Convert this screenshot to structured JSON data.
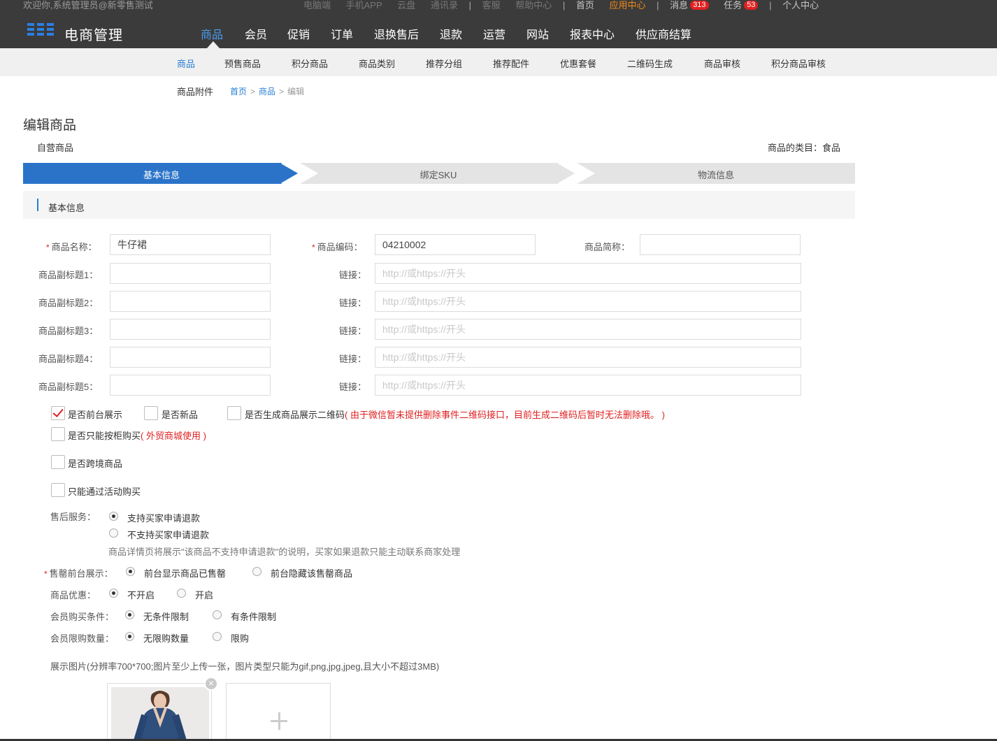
{
  "header": {
    "welcome": "欢迎你,系统管理员@新零售测试",
    "links": {
      "pc": "电脑端",
      "app": "手机APP",
      "cloud": "云盘",
      "contacts": "通讯录",
      "service": "客服",
      "help": "帮助中心",
      "home": "首页",
      "app_center": "应用中心",
      "messages": "消息",
      "messages_count": "313",
      "tasks": "任务",
      "tasks_count": "53",
      "profile": "个人中心"
    },
    "logo_text": "电商管理",
    "nav": [
      "商品",
      "会员",
      "促销",
      "订单",
      "退换售后",
      "退款",
      "运营",
      "网站",
      "报表中心",
      "供应商结算"
    ],
    "active_nav": "商品"
  },
  "subnav": [
    "商品",
    "预售商品",
    "积分商品",
    "商品类别",
    "推荐分组",
    "推荐配件",
    "优惠套餐",
    "二维码生成",
    "商品审核",
    "积分商品审核"
  ],
  "attach_label": "商品附件",
  "breadcrumb": {
    "home": "首页",
    "goods": "商品",
    "current": "编辑",
    "sep": ">"
  },
  "page_title": "编辑商品",
  "self_goods": "自营商品",
  "category": "商品的类目：食品",
  "steps": [
    "基本信息",
    "绑定SKU",
    "物流信息"
  ],
  "section_title": "基本信息",
  "form": {
    "name_label": "商品名称：",
    "name_value": "牛仔裙",
    "code_label": "商品编码：",
    "code_value": "04210002",
    "short_label": "商品简称：",
    "short_value": "",
    "link_label": "链接：",
    "link_placeholder": "http://或https://开头",
    "subtitles": [
      "商品副标题1：",
      "商品副标题2：",
      "商品副标题3：",
      "商品副标题4：",
      "商品副标题5："
    ],
    "checkboxes": {
      "front_show": "是否前台展示",
      "is_new": "是否新品",
      "qrcode": "是否生成商品展示二维码",
      "qrcode_warn": "( 由于微信暂未提供删除事件二维码接口，目前生成二维码后暂时无法删除哦。 )",
      "cabinet": "是否只能按柜购买",
      "cabinet_warn": "( 外贸商城使用 )",
      "cross_border": "是否跨境商品",
      "activity_only": "只能通过活动购买"
    },
    "after_sale_label": "售后服务：",
    "after_sale_yes": "支持买家申请退款",
    "after_sale_no": "不支持买家申请退款",
    "after_sale_note": "商品详情页将展示\"该商品不支持申请退款\"的说明，买家如果退款只能主动联系商家处理",
    "soldout_label": "售罄前台展示：",
    "soldout_show": "前台显示商品已售罄",
    "soldout_hide": "前台隐藏该售罄商品",
    "discount_label": "商品优惠：",
    "discount_off": "不开启",
    "discount_on": "开启",
    "condition_label": "会员购买条件：",
    "condition_none": "无条件限制",
    "condition_has": "有条件限制",
    "limit_label": "会员限购数量：",
    "limit_none": "无限购数量",
    "limit_has": "限购",
    "image_note": "展示图片(分辨率700*700;图片至少上传一张，图片类型只能为gif,png,jpg,jpeg,且大小不超过3MB)"
  },
  "colors": {
    "accent": "#2a73c9",
    "topbar": "#3b3b3b",
    "warn": "#e02020",
    "active_orange": "#f28b1a"
  }
}
